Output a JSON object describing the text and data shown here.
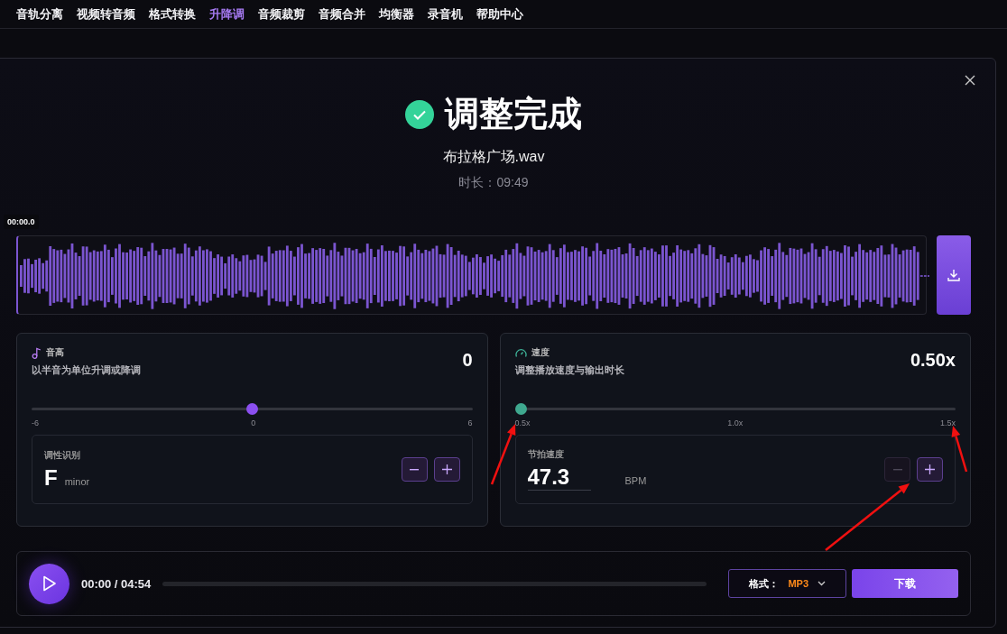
{
  "nav": {
    "items": [
      {
        "label": "音轨分离",
        "selected": false
      },
      {
        "label": "视频转音频",
        "selected": false
      },
      {
        "label": "格式转换",
        "selected": false
      },
      {
        "label": "升降调",
        "selected": true
      },
      {
        "label": "音频裁剪",
        "selected": false
      },
      {
        "label": "音频合并",
        "selected": false
      },
      {
        "label": "均衡器",
        "selected": false
      },
      {
        "label": "录音机",
        "selected": false
      },
      {
        "label": "帮助中心",
        "selected": false
      }
    ]
  },
  "dialog": {
    "title": "调整完成",
    "file_name": "布拉格广场.wav",
    "duration": "时长：09:49"
  },
  "waveform": {
    "time_marker": "00:00.0"
  },
  "pitch": {
    "title": "音高",
    "subtitle": "以半音为单位升调或降调",
    "value": "0",
    "level": 0.5,
    "ticks": [
      "-6",
      "0",
      "6"
    ],
    "key_label": "调性识别",
    "key": "F",
    "mode": "minor",
    "minus_disabled": false
  },
  "speed": {
    "title": "速度",
    "subtitle": "调整播放速度与输出时长",
    "value": "0.50x",
    "level": 0,
    "ticks": [
      "0.5x",
      "1.0x",
      "1.5x"
    ],
    "bpm_label": "节拍速度",
    "bpm": "47.3",
    "bpm_unit": "BPM",
    "minus_disabled": true
  },
  "player": {
    "time": "00:00 / 04:54",
    "format_label": "格式：",
    "format": "MP3",
    "download": "下载"
  }
}
